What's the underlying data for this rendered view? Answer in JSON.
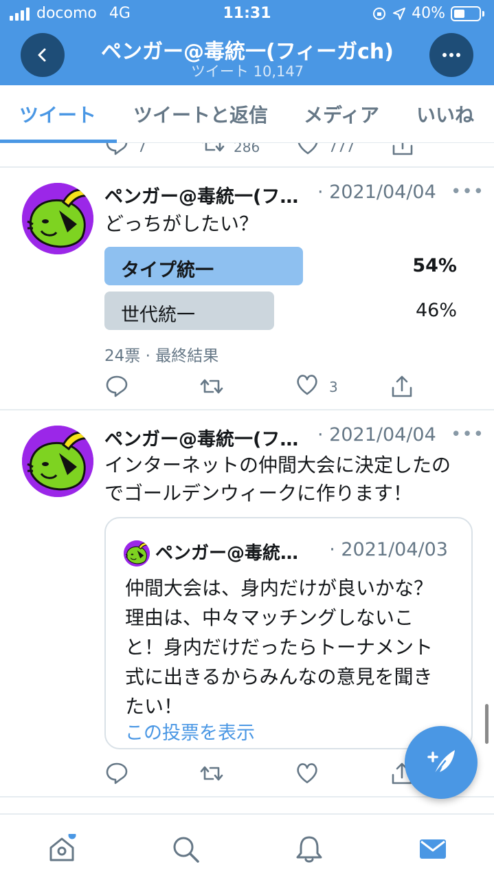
{
  "status_bar": {
    "carrier": "docomo",
    "network": "4G",
    "time": "11:31",
    "battery": "40%"
  },
  "header": {
    "title": "ペンガー@毒統一(フィーガch)",
    "subtitle": "ツイート 10,147"
  },
  "tabs": [
    {
      "label": "ツイート",
      "active": true
    },
    {
      "label": "ツイートと返信"
    },
    {
      "label": "メディア"
    },
    {
      "label": "いいね"
    }
  ],
  "partial_tweet": {
    "reply_count": "7",
    "retweet_count": "286",
    "like_count": "777"
  },
  "tweets": [
    {
      "name": "ペンガー@毒統一(フ…",
      "date": "· 2021/04/04",
      "text": "どっちがしたい？",
      "poll": {
        "options": [
          {
            "label": "タイプ統一",
            "percent": "54%",
            "share": 0.54,
            "winner": true
          },
          {
            "label": "世代統一",
            "percent": "46%",
            "share": 0.46,
            "winner": false
          }
        ],
        "meta": "24票 · 最終結果"
      },
      "like_count": "3"
    },
    {
      "name": "ペンガー@毒統一(フ…",
      "date": "· 2021/04/04",
      "text_lines": [
        "インターネットの仲間大会に決定したの",
        "でゴールデンウィークに作ります！"
      ],
      "quote": {
        "name": "ペンガー@毒統…",
        "date": "· 2021/04/03",
        "text_lines": [
          "仲間大会は、身内だけが良いかな？",
          "理由は、中々マッチングしないこ",
          "と！身内だけだったらトーナメント",
          "式に出きるからみんなの意見を聞き",
          "たい！"
        ],
        "link": "この投票を表示"
      }
    }
  ],
  "colors": {
    "accent": "#4a97e4",
    "header_bg": "#4a97e4",
    "avatar_bg": "#9b27e8",
    "poll_winner": "#8ec0f0",
    "poll_other": "#ccd6dd"
  },
  "icons": [
    "back-arrow-icon",
    "more-icon",
    "reply-icon",
    "retweet-icon",
    "like-icon",
    "share-icon",
    "compose-icon",
    "home-icon",
    "search-icon",
    "notifications-icon",
    "messages-icon"
  ]
}
